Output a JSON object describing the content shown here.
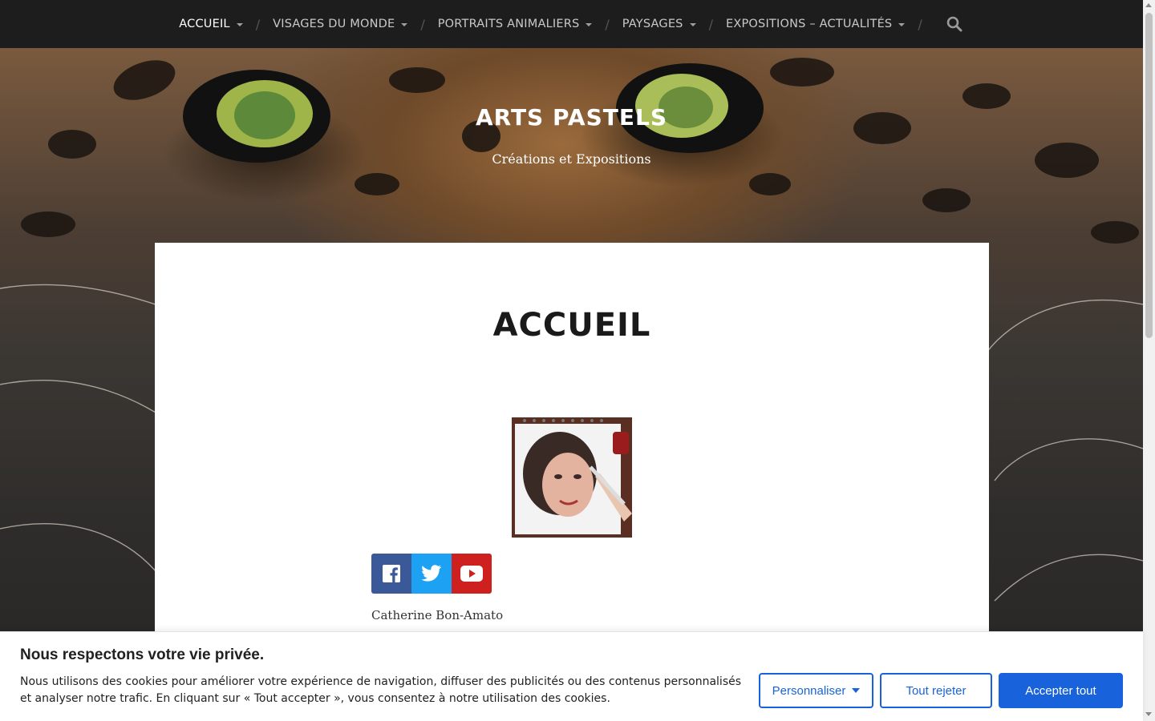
{
  "nav": {
    "items": [
      {
        "label": "ACCUEIL",
        "active": true
      },
      {
        "label": "VISAGES DU MONDE",
        "active": false
      },
      {
        "label": "PORTRAITS ANIMALIERS",
        "active": false
      },
      {
        "label": "PAYSAGES",
        "active": false
      },
      {
        "label": "EXPOSITIONS – ACTUALITÉS",
        "active": false
      }
    ],
    "separator": "/",
    "search_icon": "search-icon"
  },
  "hero": {
    "title": "ARTS PASTELS",
    "tagline": "Créations et Expositions",
    "background": "jaguar-eyes-pastel-artwork"
  },
  "main": {
    "page_title": "ACCUEIL",
    "portrait_alt": "artist-self-portrait-drawing",
    "social": [
      {
        "name": "facebook-icon",
        "color": "#3b5998"
      },
      {
        "name": "twitter-icon",
        "color": "#1da1f2"
      },
      {
        "name": "youtube-icon",
        "color": "#cd201f"
      }
    ],
    "author": "Catherine Bon-Amato"
  },
  "cookie": {
    "title": "Nous respectons votre vie privée.",
    "text": "Nous utilisons des cookies pour améliorer votre expérience de navigation, diffuser des publicités ou des contenus personnalisés et analyser notre trafic. En cliquant sur « Tout accepter », vous consentez à notre utilisation des cookies.",
    "customize_label": "Personnaliser",
    "reject_label": "Tout rejeter",
    "accept_label": "Accepter tout",
    "accent": "#1863dc"
  }
}
